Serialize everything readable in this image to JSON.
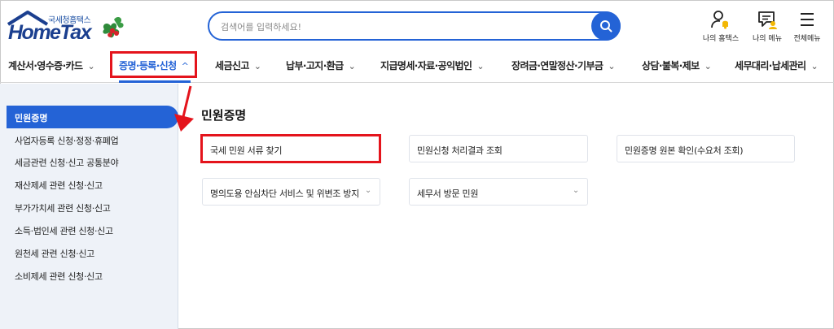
{
  "header": {
    "logo_sub": "국세청홈택스",
    "logo_main": "HomeTax",
    "search_placeholder": "검색어를 입력하세요!",
    "utils": [
      {
        "label": "나의 홈택스",
        "icon": "user-bell-icon"
      },
      {
        "label": "나의 메뉴",
        "icon": "menu-card-icon"
      },
      {
        "label": "전체메뉴",
        "icon": "hamburger-icon"
      }
    ]
  },
  "nav": {
    "items": [
      {
        "label": "계산서·영수증·카드",
        "chevron": "⌄"
      },
      {
        "label": "증명·등록·신청",
        "chevron": "^"
      },
      {
        "label": "세금신고",
        "chevron": "⌄"
      },
      {
        "label": "납부·고지·환급",
        "chevron": "⌄"
      },
      {
        "label": "지급명세·자료·공익법인",
        "chevron": "⌄"
      },
      {
        "label": "장려금·연말정산·기부금",
        "chevron": "⌄"
      },
      {
        "label": "상담·불복·제보",
        "chevron": "⌄"
      },
      {
        "label": "세무대리·납세관리",
        "chevron": "⌄"
      }
    ],
    "active_index": 1
  },
  "sidebar": {
    "items": [
      {
        "label": "민원증명"
      },
      {
        "label": "사업자등록 신청·정정·휴폐업"
      },
      {
        "label": "세금관련 신청·신고 공통분야"
      },
      {
        "label": "재산제세 관련 신청·신고"
      },
      {
        "label": "부가가치세 관련 신청·신고"
      },
      {
        "label": "소득·법인세 관련 신청·신고"
      },
      {
        "label": "원천세 관련 신청·신고"
      },
      {
        "label": "소비제세 관련 신청·신고"
      }
    ],
    "active_index": 0
  },
  "main": {
    "title": "민원증명",
    "cards": [
      {
        "label": "국세 민원 서류 찾기",
        "chevron": ""
      },
      {
        "label": "민원신청 처리결과 조회",
        "chevron": ""
      },
      {
        "label": "민원증명 원본 확인(수요처 조회)",
        "chevron": ""
      },
      {
        "label": "명의도용 안심차단 서비스 및 위변조 방지",
        "chevron": "⌄"
      },
      {
        "label": "세무서 방문 민원",
        "chevron": "⌄"
      }
    ]
  },
  "colors": {
    "brand_blue": "#2463d6",
    "highlight_red": "#e4141c",
    "sidebar_bg": "#eef2f8"
  }
}
